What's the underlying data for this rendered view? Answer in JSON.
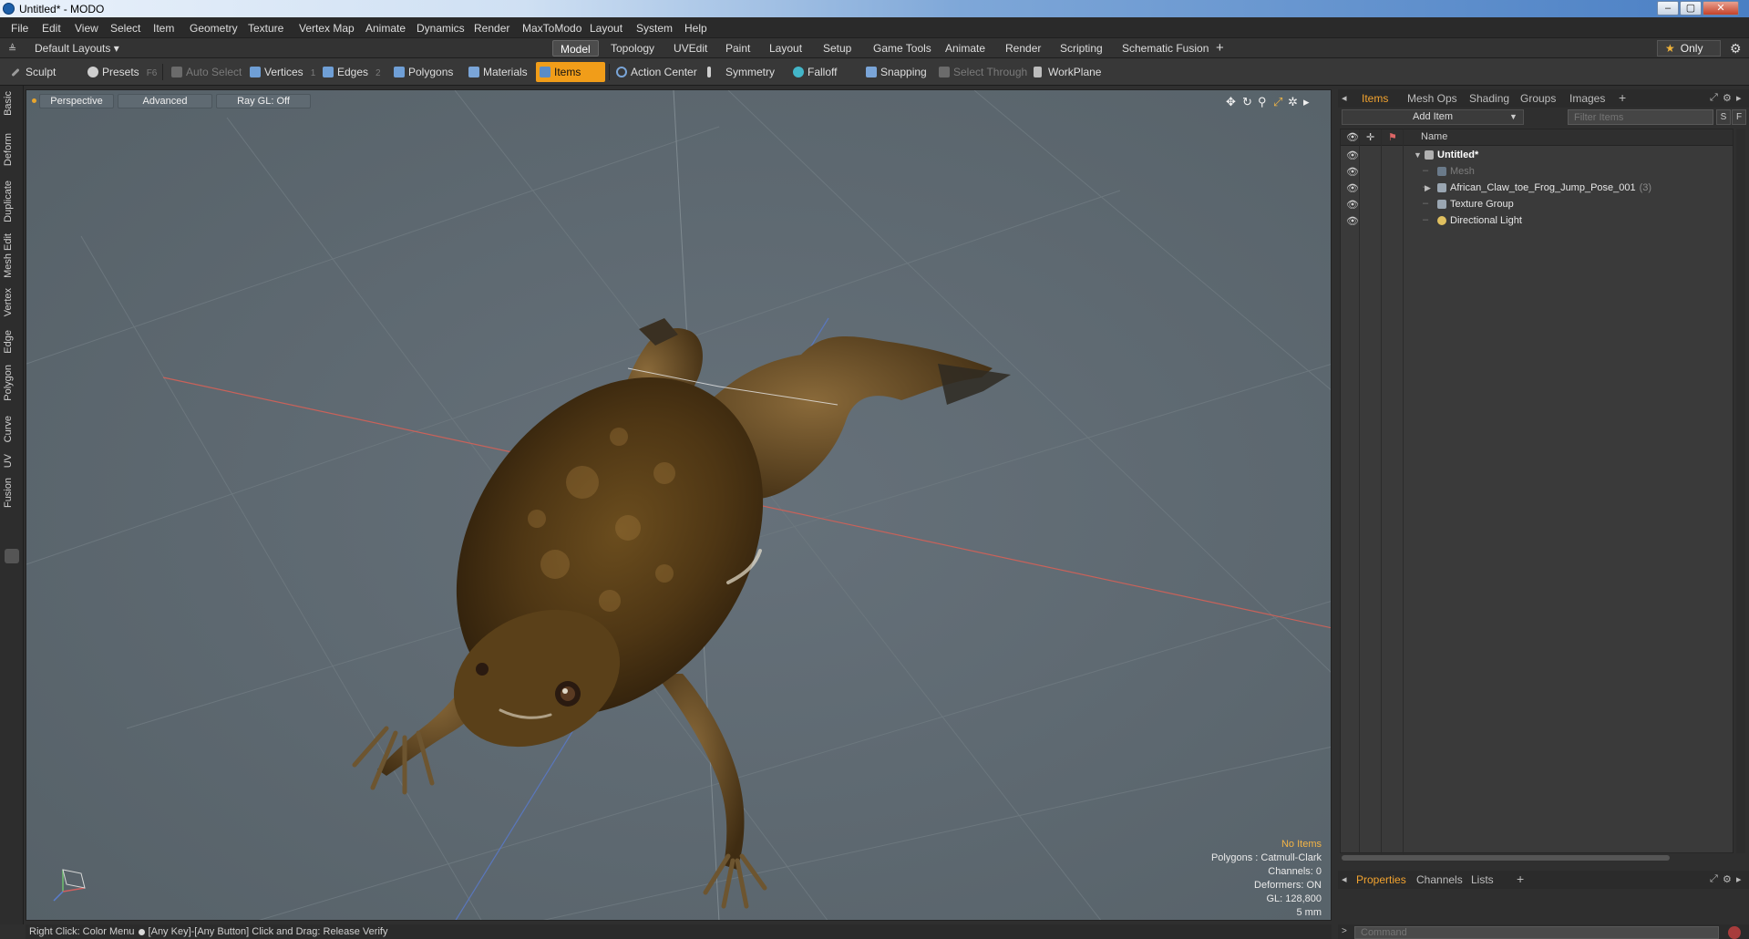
{
  "window": {
    "title": "Untitled* - MODO",
    "minimize": "–",
    "maximize": "▢",
    "close": "✕"
  },
  "menu": [
    "File",
    "Edit",
    "View",
    "Select",
    "Item",
    "Geometry",
    "Texture",
    "Vertex Map",
    "Animate",
    "Dynamics",
    "Render",
    "MaxToModo",
    "Layout",
    "System",
    "Help"
  ],
  "layouts": {
    "dropdown": "Default Layouts ▾",
    "tabs": [
      "Model",
      "Topology",
      "UVEdit",
      "Paint",
      "Layout",
      "Setup",
      "Game Tools",
      "Animate",
      "Render",
      "Scripting",
      "Schematic Fusion"
    ],
    "active_tab": "Model",
    "only_label": "Only"
  },
  "toolbar": {
    "sculpt": "Sculpt",
    "presets": "Presets",
    "presets_key": "F6",
    "auto_select": "Auto Select",
    "vertices": "Vertices",
    "vertices_key": "1",
    "edges": "Edges",
    "edges_key": "2",
    "polygons": "Polygons",
    "materials": "Materials",
    "items": "Items",
    "action_center": "Action Center",
    "symmetry": "Symmetry",
    "falloff": "Falloff",
    "snapping": "Snapping",
    "select_through": "Select Through",
    "workplane": "WorkPlane"
  },
  "left_tabs": [
    "Basic",
    "Deform",
    "Duplicate",
    "Mesh Edit",
    "Vertex",
    "Edge",
    "Polygon",
    "Curve",
    "UV",
    "Fusion"
  ],
  "viewport": {
    "view": "Perspective",
    "shading": "Advanced",
    "raygl": "Ray GL: Off",
    "info": {
      "selection": "No Items",
      "polygons": "Polygons : Catmull-Clark",
      "channels": "Channels: 0",
      "deformers": "Deformers: ON",
      "gl": "GL: 128,800",
      "scale": "5 mm"
    }
  },
  "right_panel": {
    "tabs": [
      "Items",
      "Mesh Ops",
      "Shading",
      "Groups",
      "Images"
    ],
    "active_tab": "Items",
    "add_item": "Add Item",
    "filter_placeholder": "Filter Items",
    "s_btn": "S",
    "f_btn": "F",
    "column_name": "Name",
    "tree": [
      {
        "label": "Untitled*",
        "level": 0,
        "expanded": true,
        "style": "bold"
      },
      {
        "label": "Mesh",
        "level": 1,
        "style": "dim"
      },
      {
        "label": "African_Claw_toe_Frog_Jump_Pose_001",
        "count": "(3)",
        "level": 1,
        "collapsed": true
      },
      {
        "label": "Texture Group",
        "level": 1
      },
      {
        "label": "Directional Light",
        "level": 1
      }
    ]
  },
  "bottom_panel": {
    "tabs": [
      "Properties",
      "Channels",
      "Lists"
    ],
    "active_tab": "Properties"
  },
  "command": {
    "placeholder": "Command",
    "prompt": ">"
  },
  "status": {
    "part1": "Right Click: Color Menu",
    "part2": "[Any Key]-[Any Button] Click and Drag: Release Verify"
  },
  "colors": {
    "accent": "#f19d19",
    "viewport_bg": "#5b666d"
  }
}
